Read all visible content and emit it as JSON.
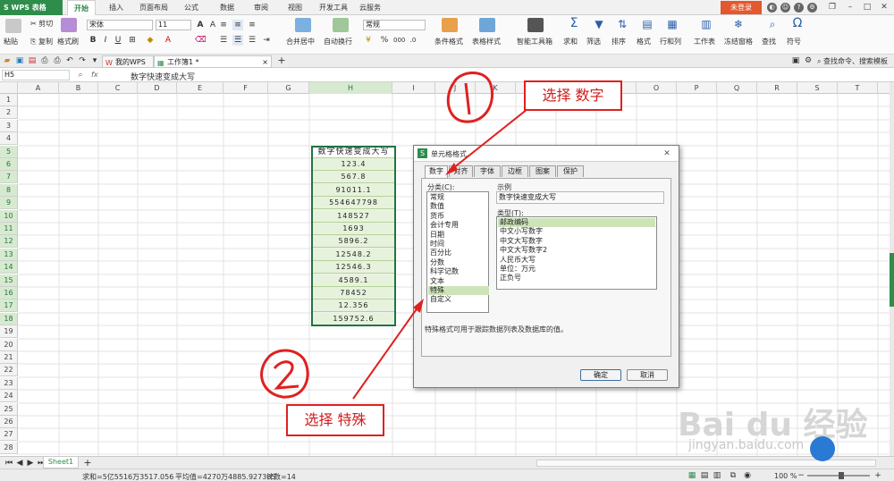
{
  "app": {
    "logo": "S WPS 表格",
    "login": "未登录"
  },
  "menus": [
    "开始",
    "插入",
    "页面布局",
    "公式",
    "数据",
    "审阅",
    "视图",
    "开发工具",
    "云服务"
  ],
  "ribbon": {
    "paste": "粘贴",
    "cut": "剪切",
    "copy": "复制",
    "format_painter": "格式刷",
    "font_name": "宋体",
    "font_size": "11",
    "bold": "B",
    "italic": "I",
    "underline": "U",
    "merge": "合并居中",
    "wrap": "自动换行",
    "number_format": "常规",
    "conditional": "条件格式",
    "table_style": "表格样式",
    "smart_toolbox": "智能工具箱",
    "sum": "求和",
    "filter": "筛选",
    "sort": "排序",
    "format": "格式",
    "rowcol": "行和列",
    "worksheet": "工作表",
    "freeze": "冻结窗格",
    "find": "查找",
    "symbol": "符号"
  },
  "tabs": [
    "我的WPS",
    "工作簿1 *"
  ],
  "search_cmd": "查找命令、搜索模板",
  "formula": {
    "namebox": "H5",
    "fx": "fx",
    "content": "数字快速变成大写"
  },
  "columns": [
    "A",
    "B",
    "C",
    "D",
    "E",
    "F",
    "G",
    "H",
    "I",
    "J",
    "K",
    "L",
    "M",
    "N",
    "O",
    "P",
    "Q",
    "R",
    "S",
    "T"
  ],
  "rows": [
    "1",
    "2",
    "3",
    "4",
    "5",
    "6",
    "7",
    "8",
    "9",
    "10",
    "11",
    "12",
    "13",
    "14",
    "15",
    "16",
    "17",
    "18",
    "19",
    "20",
    "21",
    "22",
    "23",
    "24",
    "25",
    "26",
    "27",
    "28"
  ],
  "h_column": [
    "数字快速变成大写",
    "123.4",
    "567.8",
    "91011.1",
    "554647798",
    "148527",
    "1693",
    "5896.2",
    "12548.2",
    "12546.3",
    "4589.1",
    "78452",
    "12.356",
    "159752.6"
  ],
  "sheet_tab": "Sheet1",
  "status": {
    "sum": "求和=5亿5516万3517.056",
    "avg": "平均值=4270万4885.927385",
    "count": "计数=14",
    "zoom": "100 %"
  },
  "dialog": {
    "title": "单元格格式",
    "tabs": [
      "数字",
      "对齐",
      "字体",
      "边框",
      "图案",
      "保护"
    ],
    "category_label": "分类(C):",
    "categories": [
      "常规",
      "数值",
      "货币",
      "会计专用",
      "日期",
      "时间",
      "百分比",
      "分数",
      "科学记数",
      "文本",
      "特殊",
      "自定义"
    ],
    "sample_label": "示例",
    "sample_value": "数字快速变成大写",
    "type_label": "类型(T):",
    "types": [
      "邮政编码",
      "中文小写数字",
      "中文大写数字",
      "中文大写数字2",
      "人民币大写",
      "单位：万元",
      "正负号"
    ],
    "description": "特殊格式可用于跟踪数据列表及数据库的值。",
    "ok": "确定",
    "cancel": "取消"
  },
  "annotations": {
    "step1": "选择 数字",
    "step2": "选择 特殊",
    "num1": "1",
    "num2": "2"
  },
  "watermark": {
    "brand": "Bai du 经验",
    "url": "jingyan.baidu.com"
  },
  "colors": {
    "wps_green": "#2e8d4a",
    "login_orange": "#e3582e",
    "annotation_red": "#e02020",
    "selection_green": "#217346"
  }
}
